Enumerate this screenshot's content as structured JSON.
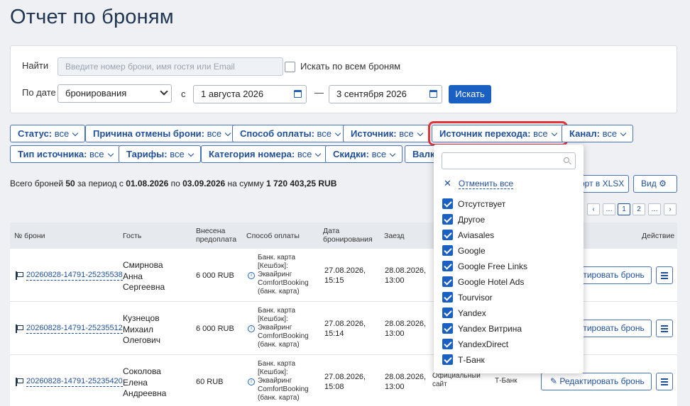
{
  "page": {
    "title": "Отчет по броням"
  },
  "search": {
    "find_label": "Найти",
    "placeholder": "Введите номер брони, имя гостя или Email",
    "all_label": "Искать по всем броням",
    "date_label": "По дате",
    "date_type": "бронирования",
    "from_label": "с",
    "date_from": "1 августа 2026",
    "dash": "—",
    "date_to": "3 сентября 2026",
    "search_button": "Искать"
  },
  "filters": [
    {
      "key": "Статус:",
      "value": "все"
    },
    {
      "key": "Причина отмены брони:",
      "value": "все"
    },
    {
      "key": "Способ оплаты:",
      "value": "все"
    },
    {
      "key": "Источник:",
      "value": "все"
    },
    {
      "key": "Источник перехода:",
      "value": "все"
    },
    {
      "key": "Канал:",
      "value": "все"
    },
    {
      "key": "Тип источника:",
      "value": "все"
    },
    {
      "key": "Тарифы:",
      "value": "все"
    },
    {
      "key": "Категория номера:",
      "value": "все"
    },
    {
      "key": "Скидки:",
      "value": "все"
    },
    {
      "key": "Валк",
      "value": ""
    }
  ],
  "summary": {
    "p1": "Всего броней ",
    "count": "50",
    "p2": " за период с ",
    "from": "01.08.2026",
    "p3": " по ",
    "to": "03.09.2026",
    "p4": " на сумму ",
    "sum": "1 720 403,25 RUB"
  },
  "toolbar": {
    "export_label": "орт в XLSX",
    "view_label": "Вид"
  },
  "pagination": {
    "prev": "‹",
    "dots1": "…",
    "p1": "1",
    "p2": "2",
    "dots2": "…",
    "next": "›"
  },
  "table": {
    "headers": {
      "number": "№ брони",
      "guest": "Гость",
      "prepaid_1": "Внесена",
      "prepaid_2": "предоплата",
      "pay": "Способ оплаты",
      "date_1": "Дата",
      "date_2": "бронирования",
      "arrival": "Заезд",
      "action": "Действие"
    },
    "rows": [
      {
        "number": "20260828-14791-25235538",
        "guest": [
          "Смирнова",
          "Анна",
          "Сергеевна"
        ],
        "prepaid": "6 000 RUB",
        "pay": [
          "Банк. карта",
          "[Кешбэк]:",
          "Эквайринг",
          "ComfortBooking",
          "(банк. карта)"
        ],
        "booked": [
          "27.08.2026,",
          "15:15"
        ],
        "arrival": [
          "28.08.2026,",
          "13:00"
        ],
        "edit": "Редактировать бронь"
      },
      {
        "number": "20260828-14791-25235512",
        "guest": [
          "Кузнецов",
          "Михаил",
          "Олегович"
        ],
        "prepaid": "6 000 RUB",
        "pay": [
          "Банк. карта",
          "[Кешбэк]:",
          "Эквайринг",
          "ComfortBooking",
          "(банк. карта)"
        ],
        "booked": [
          "27.08.2026,",
          "15:14"
        ],
        "arrival": [
          "28.08.2026,",
          "13:00"
        ],
        "edit": "Редактировать бронь"
      },
      {
        "number": "20260828-14791-25235420",
        "guest": [
          "Соколова",
          "Елена",
          "Андреевна"
        ],
        "prepaid": "60 RUB",
        "pay": [
          "Банк. карта",
          "[Кешбэк]:",
          "Эквайринг",
          "ComfortBooking",
          "(банк. карта)"
        ],
        "booked": [
          "27.08.2026,",
          "15:08"
        ],
        "arrival": [
          "28.08.2026,",
          "13:00"
        ],
        "source_1": "Официальный",
        "source_2": "сайт",
        "channel": "Т-Банк",
        "edit": "Редактировать бронь"
      }
    ]
  },
  "dropdown": {
    "clear_icon": "✕",
    "clear_label": "Отменить все",
    "options": [
      "Отсутствует",
      "Другое",
      "Aviasales",
      "Google",
      "Google Free Links",
      "Google Hotel Ads",
      "Tourvisor",
      "Yandex",
      "Yandex Витрина",
      "YandexDirect",
      "Т-Банк"
    ]
  }
}
